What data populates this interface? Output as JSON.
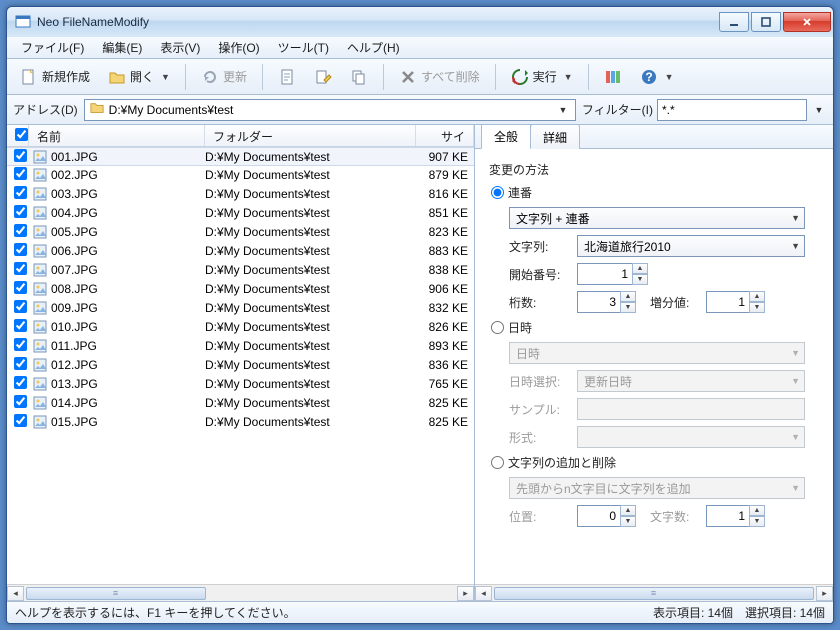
{
  "title": "Neo FileNameModify",
  "menu": [
    "ファイル(F)",
    "編集(E)",
    "表示(V)",
    "操作(O)",
    "ツール(T)",
    "ヘルプ(H)"
  ],
  "toolbar": {
    "new": "新規作成",
    "open": "開く",
    "update": "更新",
    "delete_all": "すべて削除",
    "run": "実行"
  },
  "addressbar": {
    "label": "アドレス(D)",
    "path": "D:¥My Documents¥test",
    "filter_label": "フィルター(I)",
    "filter_value": "*.*"
  },
  "columns": {
    "name": "名前",
    "folder": "フォルダー",
    "size": "サイ"
  },
  "files": [
    {
      "name": "001.JPG",
      "folder": "D:¥My Documents¥test",
      "size": "907 KE"
    },
    {
      "name": "002.JPG",
      "folder": "D:¥My Documents¥test",
      "size": "879 KE"
    },
    {
      "name": "003.JPG",
      "folder": "D:¥My Documents¥test",
      "size": "816 KE"
    },
    {
      "name": "004.JPG",
      "folder": "D:¥My Documents¥test",
      "size": "851 KE"
    },
    {
      "name": "005.JPG",
      "folder": "D:¥My Documents¥test",
      "size": "823 KE"
    },
    {
      "name": "006.JPG",
      "folder": "D:¥My Documents¥test",
      "size": "883 KE"
    },
    {
      "name": "007.JPG",
      "folder": "D:¥My Documents¥test",
      "size": "838 KE"
    },
    {
      "name": "008.JPG",
      "folder": "D:¥My Documents¥test",
      "size": "906 KE"
    },
    {
      "name": "009.JPG",
      "folder": "D:¥My Documents¥test",
      "size": "832 KE"
    },
    {
      "name": "010.JPG",
      "folder": "D:¥My Documents¥test",
      "size": "826 KE"
    },
    {
      "name": "011.JPG",
      "folder": "D:¥My Documents¥test",
      "size": "893 KE"
    },
    {
      "name": "012.JPG",
      "folder": "D:¥My Documents¥test",
      "size": "836 KE"
    },
    {
      "name": "013.JPG",
      "folder": "D:¥My Documents¥test",
      "size": "765 KE"
    },
    {
      "name": "014.JPG",
      "folder": "D:¥My Documents¥test",
      "size": "825 KE"
    },
    {
      "name": "015.JPG",
      "folder": "D:¥My Documents¥test",
      "size": "825 KE"
    }
  ],
  "tabs": {
    "general": "全般",
    "detail": "詳細"
  },
  "panel": {
    "method_title": "変更の方法",
    "radio_renban": "連番",
    "combo_mode": "文字列 + 連番",
    "str_label": "文字列:",
    "str_value": "北海道旅行2010",
    "start_label": "開始番号:",
    "start_value": "1",
    "digits_label": "桁数:",
    "digits_value": "3",
    "incr_label": "増分値:",
    "incr_value": "1",
    "radio_datetime": "日時",
    "combo_datetime": "日時",
    "dt_select_label": "日時選択:",
    "dt_select_value": "更新日時",
    "sample_label": "サンプル:",
    "format_label": "形式:",
    "radio_addremove": "文字列の追加と削除",
    "combo_addremove": "先頭からn文字目に文字列を追加",
    "pos_label": "位置:",
    "pos_value": "0",
    "chars_label": "文字数:",
    "chars_value": "1"
  },
  "status": {
    "help": "ヘルプを表示するには、F1 キーを押してください。",
    "count": "表示項目: 14個",
    "selected": "選択項目: 14個"
  }
}
